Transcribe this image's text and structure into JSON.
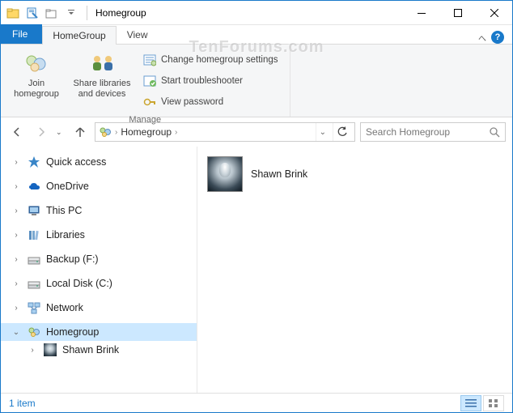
{
  "window": {
    "title": "Homegroup"
  },
  "tabs": {
    "file": "File",
    "homegroup": "HomeGroup",
    "view": "View"
  },
  "ribbon": {
    "join": "Join homegroup",
    "share": "Share libraries and devices",
    "change_settings": "Change homegroup settings",
    "start_troubleshooter": "Start troubleshooter",
    "view_password": "View password",
    "group_label": "Manage"
  },
  "address": {
    "crumb1": "Homegroup"
  },
  "search": {
    "placeholder": "Search Homegroup"
  },
  "tree": {
    "quick_access": "Quick access",
    "onedrive": "OneDrive",
    "this_pc": "This PC",
    "libraries": "Libraries",
    "backup": "Backup (F:)",
    "local_disk": "Local Disk (C:)",
    "network": "Network",
    "homegroup": "Homegroup",
    "user": "Shawn Brink"
  },
  "content": {
    "item1": "Shawn Brink"
  },
  "status": {
    "count": "1 item"
  },
  "watermark": "TenForums.com"
}
